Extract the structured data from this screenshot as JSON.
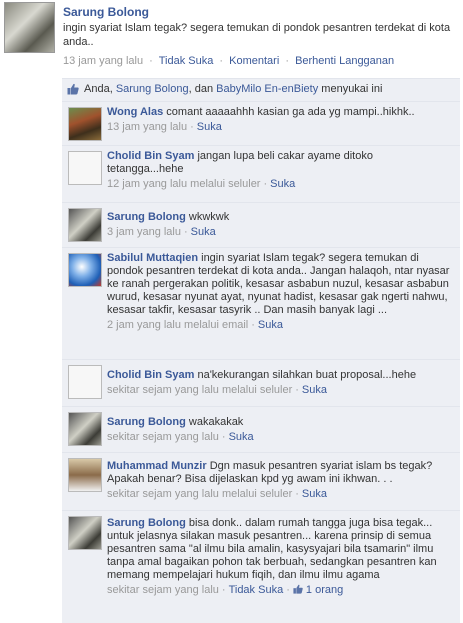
{
  "post": {
    "author": "Sarung Bolong",
    "text": "ingin syariat Islam tegak? segera temukan di pondok pesantren terdekat di kota anda..",
    "time": "13 jam yang lalu",
    "sep": "·",
    "actions": [
      "Tidak Suka",
      "Komentari",
      "Berhenti Langganan"
    ]
  },
  "likes": {
    "prefix": "Anda, ",
    "name1": "Sarung Bolong",
    "mid": ", dan ",
    "name2": "BabyMilo En-enBiety",
    "suffix": " menyukai ini"
  },
  "comments": [
    {
      "author": "Wong Alas",
      "text": "comant aaaaahhh kasian ga ada yg mampi..hikhk..",
      "time": "13 jam yang lalu",
      "source": "",
      "action": "Suka"
    },
    {
      "author": "Cholid Bin Syam",
      "text": "jangan lupa beli cakar ayame ditoko tetangga...hehe",
      "time": "12 jam yang lalu melalui seluler",
      "source": "",
      "action": "Suka"
    },
    {
      "author": "Sarung Bolong",
      "text": "wkwkwk",
      "time": "3 jam yang lalu",
      "source": "",
      "action": "Suka"
    },
    {
      "author": "Sabilul Muttaqien",
      "text": "ingin syariat Islam tegak? segera temukan di pondok pesantren terdekat di kota anda.. Jangan halaqoh, ntar nyasar ke ranah pergerakan politik, kesasar asbabun nuzul, kesasar asbabun wurud, kesasar nyunat ayat, nyunat hadist, kesasar gak ngerti nahwu, kesasar takfir, kesasar tasyrik .. Dan masih banyak lagi ...",
      "time": "2 jam yang lalu melalui email",
      "source": "",
      "action": "Suka"
    },
    {
      "author": "Cholid Bin Syam",
      "text": "na'kekurangan silahkan buat proposal...hehe",
      "time": "sekitar sejam yang lalu melalui seluler",
      "source": "",
      "action": "Suka"
    },
    {
      "author": "Sarung Bolong",
      "text": "wakakakak",
      "time": "sekitar sejam yang lalu",
      "source": "",
      "action": "Suka"
    },
    {
      "author": "Muhammad Munzir",
      "text": "Dgn masuk pesantren syariat islam bs tegak? Apakah benar? Bisa dijelaskan kpd yg awam ini ikhwan. . .",
      "time": "sekitar sejam yang lalu melalui seluler",
      "source": "",
      "action": "Suka"
    },
    {
      "author": "Sarung Bolong",
      "text": "bisa donk.. dalam rumah tangga juga bisa tegak... untuk jelasnya silakan masuk pesantren... karena prinsip di semua pesantren sama \"al ilmu bila amalin, kasysyajari bila tsamarin\" ilmu tanpa amal bagaikan pohon tak berbuah, sedangkan pesantren kan memang mempelajari hukum fiqih, dan ilmu ilmu agama",
      "time": "sekitar sejam yang lalu",
      "source": "",
      "action": "Tidak Suka",
      "likes": "1 orang"
    }
  ]
}
